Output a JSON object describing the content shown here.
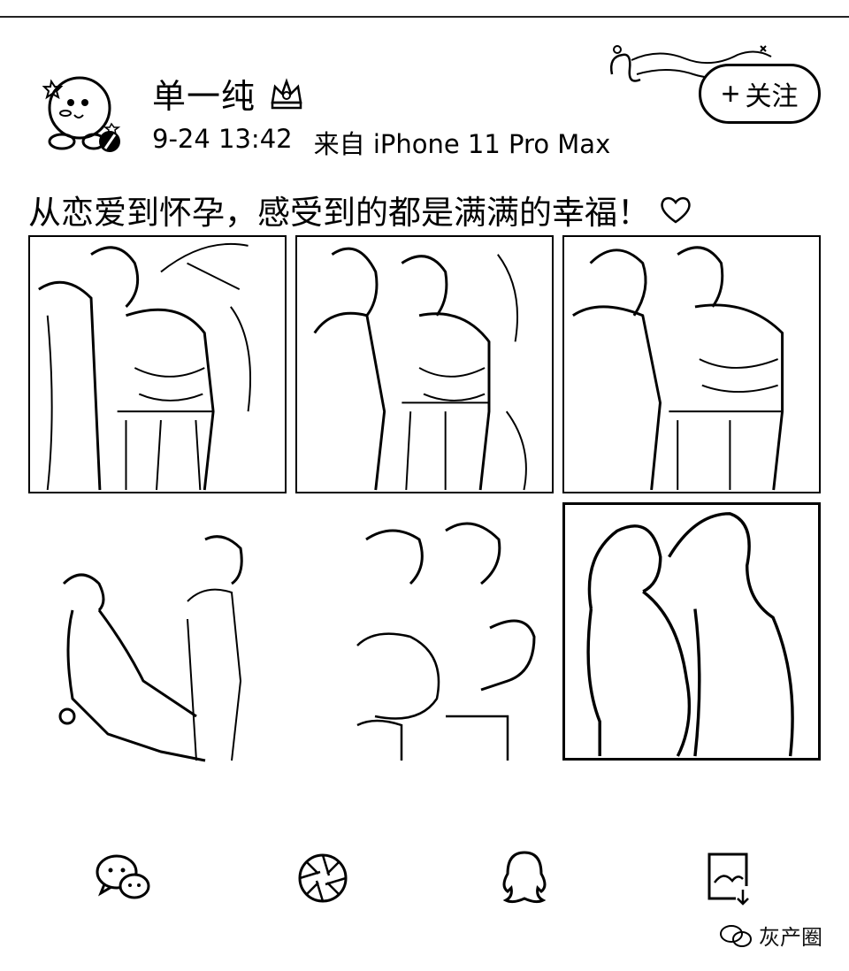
{
  "user": {
    "name": "单一纯"
  },
  "meta": {
    "time": "9-24 13:42",
    "source": "来自 iPhone 11 Pro Max"
  },
  "follow": {
    "label": "关注",
    "plus": "+"
  },
  "post": {
    "text": "从恋爱到怀孕，感受到的都是满满的幸福！"
  },
  "share": [
    "wechat-icon",
    "moments-icon",
    "qq-icon",
    "save-image-icon"
  ],
  "watermark": {
    "text": "灰产圈"
  }
}
